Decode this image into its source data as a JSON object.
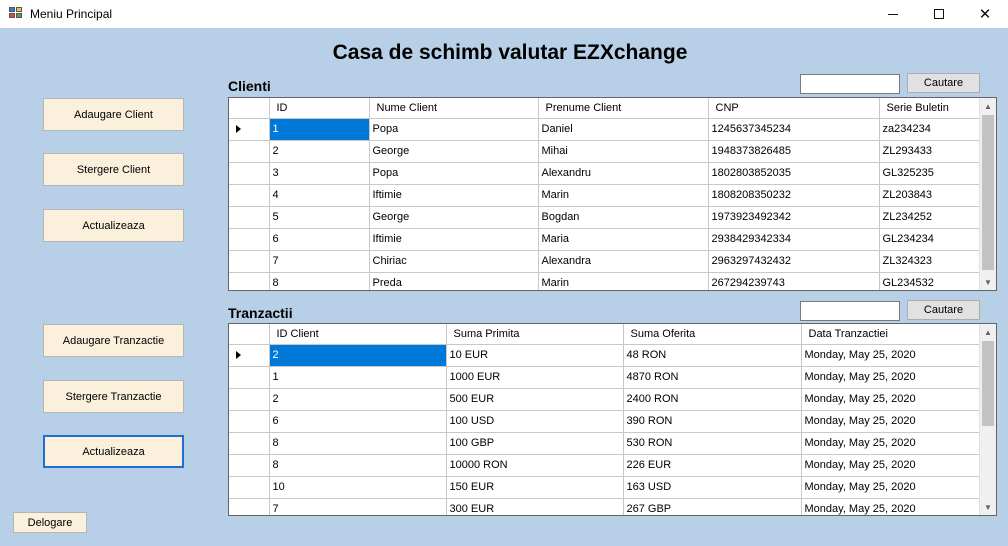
{
  "window": {
    "title": "Meniu Principal",
    "icon": "app-window-icon",
    "controls": {
      "minimize": "minimize-icon",
      "maximize": "maximize-icon",
      "close": "close-icon"
    }
  },
  "heading": "Casa de schimb valutar EZXchange",
  "colors": {
    "background": "#b8cfe8",
    "button": "#fbf0dc",
    "selection": "#0078d7",
    "focus": "#1f6fd1"
  },
  "sidebar": {
    "add_client": "Adaugare Client",
    "delete_client": "Stergere Client",
    "update_clients": "Actualizeaza",
    "add_transaction": "Adaugare Tranzactie",
    "delete_transaction": "Stergere Tranzactie",
    "update_transactions": "Actualizeaza"
  },
  "logout": "Delogare",
  "clients": {
    "label": "Clienti",
    "search_value": "",
    "search_button": "Cautare",
    "columns": [
      "ID",
      "Nume Client",
      "Prenume Client",
      "CNP",
      "Serie Buletin"
    ],
    "rows": [
      [
        "1",
        "Popa",
        "Daniel",
        "1245637345234",
        "za234234"
      ],
      [
        "2",
        "George",
        "Mihai",
        "1948373826485",
        "ZL293433"
      ],
      [
        "3",
        "Popa",
        "Alexandru",
        "1802803852035",
        "GL325235"
      ],
      [
        "4",
        "Iftimie",
        "Marin",
        "1808208350232",
        "ZL203843"
      ],
      [
        "5",
        "George",
        "Bogdan",
        "1973923492342",
        "ZL234252"
      ],
      [
        "6",
        "Iftimie",
        "Maria",
        "2938429342334",
        "GL234234"
      ],
      [
        "7",
        "Chiriac",
        "Alexandra",
        "2963297432432",
        "ZL324323"
      ],
      [
        "8",
        "Preda",
        "Marin",
        "267294239743",
        "GL234532"
      ]
    ]
  },
  "transactions": {
    "label": "Tranzactii",
    "search_value": "",
    "search_button": "Cautare",
    "columns": [
      "ID Client",
      "Suma Primita",
      "Suma Oferita",
      "Data Tranzactiei"
    ],
    "rows": [
      [
        "2",
        "10 EUR",
        "48 RON",
        "Monday, May 25, 2020"
      ],
      [
        "1",
        "1000 EUR",
        "4870 RON",
        "Monday, May 25, 2020"
      ],
      [
        "2",
        "500 EUR",
        "2400 RON",
        "Monday, May 25, 2020"
      ],
      [
        "6",
        "100 USD",
        "390 RON",
        "Monday, May 25, 2020"
      ],
      [
        "8",
        "100 GBP",
        "530 RON",
        "Monday, May 25, 2020"
      ],
      [
        "8",
        "10000 RON",
        "226 EUR",
        "Monday, May 25, 2020"
      ],
      [
        "10",
        "150 EUR",
        "163 USD",
        "Monday, May 25, 2020"
      ],
      [
        "7",
        "300 EUR",
        "267 GBP",
        "Monday, May 25, 2020"
      ]
    ]
  }
}
